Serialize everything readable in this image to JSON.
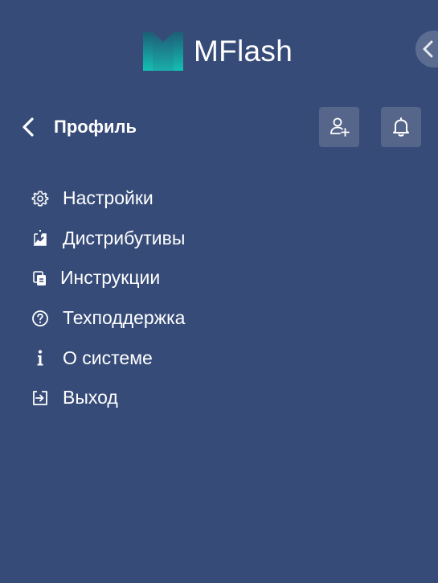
{
  "app": {
    "logo_text": "MFlash"
  },
  "header": {
    "title": "Профиль",
    "back_icon": "chevron-left-icon",
    "add_user_icon": "add-user-icon",
    "notifications_icon": "bell-icon"
  },
  "menu": {
    "items": [
      {
        "label": "Настройки",
        "icon": "gear-icon"
      },
      {
        "label": "Дистрибутивы",
        "icon": "download-icon"
      },
      {
        "label": "Инструкции",
        "icon": "documents-icon"
      },
      {
        "label": "Техподдержка",
        "icon": "help-circle-icon"
      },
      {
        "label": "О системе",
        "icon": "info-icon"
      },
      {
        "label": "Выход",
        "icon": "logout-icon"
      }
    ]
  },
  "colors": {
    "background": "#364b78",
    "button_bg": "#56668a",
    "logo_gradient_top": "#0e7a82",
    "logo_gradient_bottom": "#12c2b4",
    "text": "#ffffff"
  }
}
